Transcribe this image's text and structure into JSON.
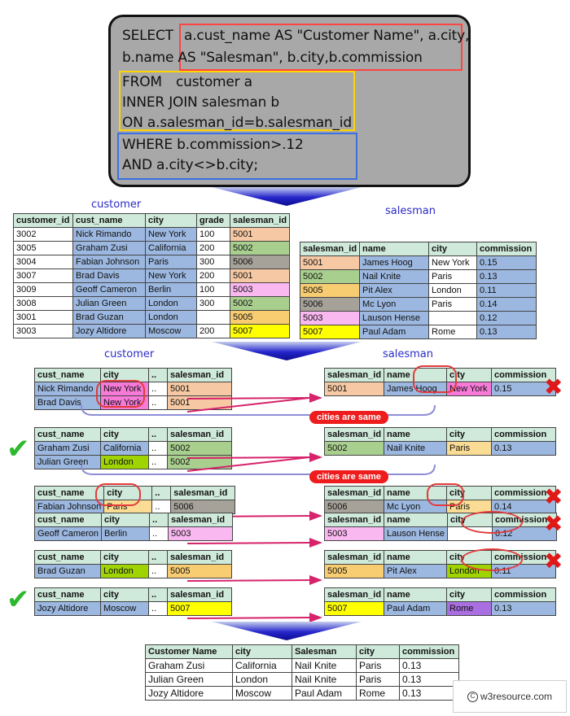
{
  "sql": {
    "lines": [
      "SELECT",
      "a.cust_name AS \"Customer Name\", a.city,",
      "b.name AS \"Salesman\", b.city,b.commission",
      "FROM",
      "customer a",
      "INNER JOIN salesman b",
      "ON a.salesman_id=b.salesman_id",
      "WHERE b.commission>.12",
      "AND a.city<>b.city;"
    ],
    "highlight_colors": {
      "select": "#ff4444",
      "from": "#ffd400",
      "where": "#3b6fe0"
    }
  },
  "titles": {
    "customer": "customer",
    "salesman": "salesman"
  },
  "customer_table": {
    "headers": [
      "customer_id",
      "cust_name",
      "city",
      "grade",
      "salesman_id"
    ],
    "rows": [
      [
        "3002",
        "Nick Rimando",
        "New York",
        "100",
        "5001"
      ],
      [
        "3005",
        "Graham Zusi",
        "California",
        "200",
        "5002"
      ],
      [
        "3004",
        "Fabian Johnson",
        "Paris",
        "300",
        "5006"
      ],
      [
        "3007",
        "Brad Davis",
        "New York",
        "200",
        "5001"
      ],
      [
        "3009",
        "Geoff Cameron",
        "Berlin",
        "100",
        "5003"
      ],
      [
        "3008",
        "Julian Green",
        "London",
        "300",
        "5002"
      ],
      [
        "3001",
        "Brad Guzan",
        "London",
        "",
        "5005"
      ],
      [
        "3003",
        "Jozy Altidore",
        "Moscow",
        "200",
        "5007"
      ]
    ],
    "row_colors": [
      [
        "c-white",
        "c-blue",
        "c-blue",
        "c-white",
        "c-peach"
      ],
      [
        "c-white",
        "c-blue",
        "c-blue",
        "c-white",
        "c-green"
      ],
      [
        "c-white",
        "c-blue",
        "c-blue",
        "c-white",
        "c-gray"
      ],
      [
        "c-white",
        "c-blue",
        "c-blue",
        "c-white",
        "c-peach"
      ],
      [
        "c-white",
        "c-blue",
        "c-blue",
        "c-white",
        "c-pink"
      ],
      [
        "c-white",
        "c-blue",
        "c-blue",
        "c-white",
        "c-green"
      ],
      [
        "c-white",
        "c-blue",
        "c-blue",
        "c-white",
        "c-orange"
      ],
      [
        "c-white",
        "c-blue",
        "c-blue",
        "c-white",
        "c-yellow"
      ]
    ]
  },
  "salesman_table": {
    "headers": [
      "salesman_id",
      "name",
      "city",
      "commission"
    ],
    "rows": [
      [
        "5001",
        "James Hoog",
        "New York",
        "0.15"
      ],
      [
        "5002",
        "Nail Knite",
        "Paris",
        "0.13"
      ],
      [
        "5005",
        "Pit Alex",
        "London",
        "0.11"
      ],
      [
        "5006",
        "Mc Lyon",
        "Paris",
        "0.14"
      ],
      [
        "5003",
        "Lauson Hense",
        "",
        "0.12"
      ],
      [
        "5007",
        "Paul Adam",
        "Rome",
        "0.13"
      ]
    ],
    "row_colors": [
      [
        "c-peach",
        "c-blue",
        "c-white",
        "c-blue"
      ],
      [
        "c-green",
        "c-blue",
        "c-white",
        "c-blue"
      ],
      [
        "c-orange",
        "c-blue",
        "c-white",
        "c-blue"
      ],
      [
        "c-gray",
        "c-blue",
        "c-white",
        "c-blue"
      ],
      [
        "c-pink",
        "c-blue",
        "c-white",
        "c-blue"
      ],
      [
        "c-yellow",
        "c-blue",
        "c-white",
        "c-blue"
      ]
    ]
  },
  "compare": {
    "cust_headers": [
      "cust_name",
      "city",
      "..",
      "salesman_id"
    ],
    "sales_headers": [
      "salesman_id",
      "name",
      "city",
      "commission"
    ],
    "groups": [
      {
        "mark": "x",
        "note": "cities are same",
        "cust_rows": [
          [
            "Nick Rimando",
            "New York",
            "..",
            "5001"
          ],
          [
            "Brad Davis",
            "New York",
            "..",
            "5001"
          ]
        ],
        "cust_colors": [
          [
            "c-blue",
            "c-magenta",
            "c-white",
            "c-peach"
          ],
          [
            "c-blue",
            "c-magenta",
            "c-white",
            "c-peach"
          ]
        ],
        "sales_rows": [
          [
            "5001",
            "James Hoog",
            "New York",
            "0.15"
          ]
        ],
        "sales_colors": [
          [
            "c-peach",
            "c-blue",
            "c-magenta",
            "c-blue"
          ]
        ]
      },
      {
        "mark": "tick",
        "note": "cities are same",
        "cust_rows": [
          [
            "Graham Zusi",
            "California",
            "..",
            "5002"
          ],
          [
            "Julian Green",
            "London",
            "..",
            "5002"
          ]
        ],
        "cust_colors": [
          [
            "c-blue",
            "c-blue",
            "c-white",
            "c-green"
          ],
          [
            "c-blue",
            "c-lime",
            "c-white",
            "c-green"
          ]
        ],
        "sales_rows": [
          [
            "5002",
            "Nail Knite",
            "Paris",
            "0.13"
          ]
        ],
        "sales_colors": [
          [
            "c-green",
            "c-blue",
            "c-ltorange",
            "c-blue"
          ]
        ]
      },
      {
        "mark": "x",
        "note": "",
        "cust_rows": [
          [
            "Fabian Johnson",
            "Paris",
            "..",
            "5006"
          ]
        ],
        "cust_colors": [
          [
            "c-blue",
            "c-ltorange",
            "c-white",
            "c-gray"
          ]
        ],
        "sales_rows": [
          [
            "5006",
            "Mc Lyon",
            "Paris",
            "0.14"
          ]
        ],
        "sales_colors": [
          [
            "c-gray",
            "c-blue",
            "c-ltorange",
            "c-blue"
          ]
        ]
      },
      {
        "mark": "x",
        "note": "",
        "cust_rows": [
          [
            "Geoff Cameron",
            "Berlin",
            "..",
            "5003"
          ]
        ],
        "cust_colors": [
          [
            "c-blue",
            "c-blue",
            "c-white",
            "c-pink"
          ]
        ],
        "sales_rows": [
          [
            "5003",
            "Lauson Hense",
            "",
            "0.12"
          ]
        ],
        "sales_colors": [
          [
            "c-pink",
            "c-blue",
            "c-white",
            "c-blue"
          ]
        ]
      },
      {
        "mark": "x",
        "note": "",
        "cust_rows": [
          [
            "Brad Guzan",
            "London",
            "..",
            "5005"
          ]
        ],
        "cust_colors": [
          [
            "c-blue",
            "c-lime",
            "c-white",
            "c-orange"
          ]
        ],
        "sales_rows": [
          [
            "5005",
            "Pit Alex",
            "London",
            "0.11"
          ]
        ],
        "sales_colors": [
          [
            "c-orange",
            "c-blue",
            "c-lime",
            "c-blue"
          ]
        ]
      },
      {
        "mark": "tick",
        "note": "",
        "cust_rows": [
          [
            "Jozy Altidore",
            "Moscow",
            "..",
            "5007"
          ]
        ],
        "cust_colors": [
          [
            "c-blue",
            "c-blue",
            "c-white",
            "c-yellow"
          ]
        ],
        "sales_rows": [
          [
            "5007",
            "Paul Adam",
            "Rome",
            "0.13"
          ]
        ],
        "sales_colors": [
          [
            "c-yellow",
            "c-blue",
            "c-purple",
            "c-blue"
          ]
        ]
      }
    ]
  },
  "result_table": {
    "headers": [
      "Customer Name",
      "city",
      "Salesman",
      "city",
      "commission"
    ],
    "rows": [
      [
        "Graham Zusi",
        "California",
        "Nail Knite",
        "Paris",
        "0.13"
      ],
      [
        "Julian Green",
        "London",
        "Nail Knite",
        "Paris",
        "0.13"
      ],
      [
        "Jozy Altidore",
        "Moscow",
        "Paul Adam",
        "Rome",
        "0.13"
      ]
    ]
  },
  "watermark": {
    "text": "w3resource.com",
    "symbol": "C"
  }
}
